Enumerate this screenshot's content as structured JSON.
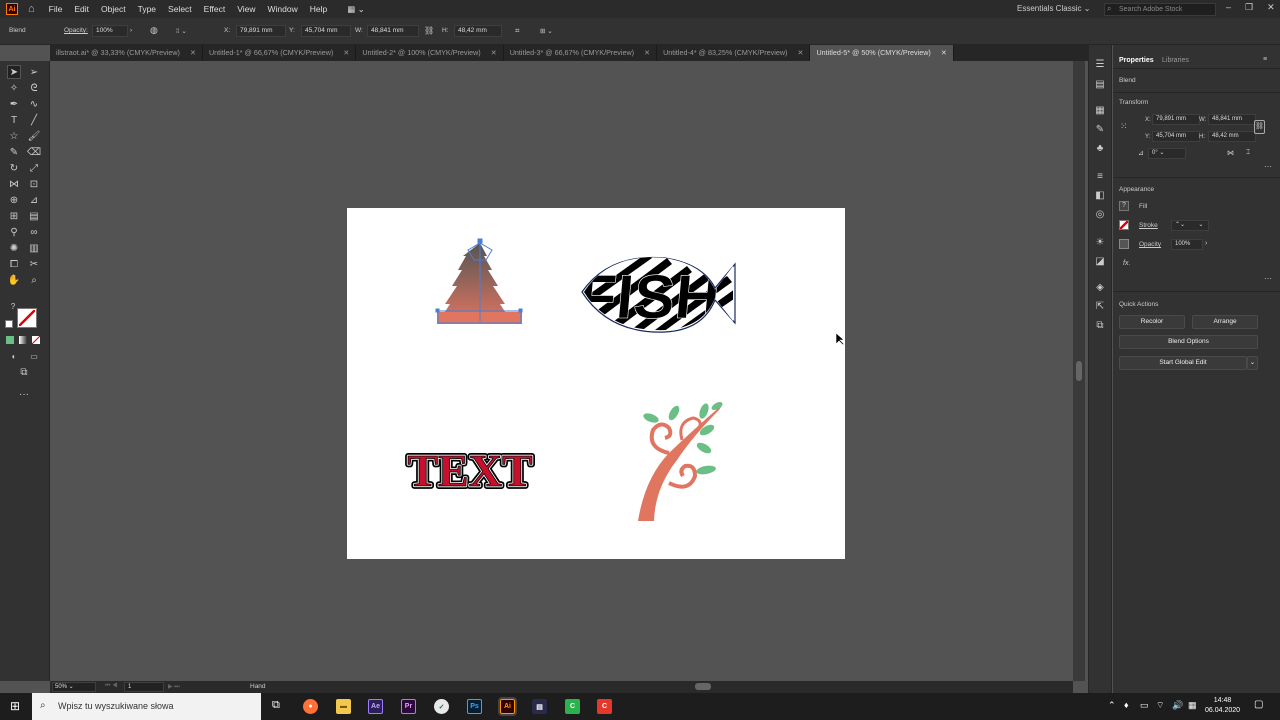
{
  "menubar": {
    "logo": "Ai",
    "home_icon": "home-icon",
    "items": [
      "File",
      "Edit",
      "Object",
      "Type",
      "Select",
      "Effect",
      "View",
      "Window",
      "Help"
    ],
    "workspace": "Essentials Classic",
    "search_placeholder": "Search Adobe Stock"
  },
  "controlbar": {
    "selection_label": "Blend",
    "opacity_label": "Opacity:",
    "opacity_value": "100%",
    "x_label": "X:",
    "x_value": "79,891 mm",
    "y_label": "Y:",
    "y_value": "45,704 mm",
    "w_label": "W:",
    "w_value": "48,841 mm",
    "h_label": "H:",
    "h_value": "48,42 mm"
  },
  "tabs": [
    {
      "label": "illstraot.ai* @ 33,33% (CMYK/Preview)",
      "active": false
    },
    {
      "label": "Untitled-1* @ 66,67% (CMYK/Preview)",
      "active": false
    },
    {
      "label": "Untitled-2* @ 100% (CMYK/Preview)",
      "active": false
    },
    {
      "label": "Untitled-3* @ 66,67% (CMYK/Preview)",
      "active": false
    },
    {
      "label": "Untitled-4* @ 83,25% (CMYK/Preview)",
      "active": false
    },
    {
      "label": "Untitled-5* @ 50% (CMYK/Preview)",
      "active": true
    }
  ],
  "artwork": {
    "fish_text": "FISH",
    "text_word": "TEXT",
    "colors": {
      "salmon": "#e07560",
      "leaf": "#6bbf86",
      "red": "#c8102e",
      "selection": "#4a7ed8"
    }
  },
  "statusbar": {
    "zoom": "50%",
    "artboard_num": "1",
    "tool": "Hand"
  },
  "panel": {
    "tab_properties": "Properties",
    "tab_libraries": "Libraries",
    "selection": "Blend",
    "transform_title": "Transform",
    "x_label": "X:",
    "x_value": "79,891 mm",
    "y_label": "Y:",
    "y_value": "45,704 mm",
    "w_label": "W:",
    "w_value": "48,841 mm",
    "h_label": "H:",
    "h_value": "48,42 mm",
    "angle_value": "0°",
    "appearance_title": "Appearance",
    "fill_label": "Fill",
    "stroke_label": "Stroke",
    "opacity_label": "Opacity",
    "opacity_value": "100%",
    "fx_label": "fx.",
    "quick_actions_title": "Quick Actions",
    "recolor": "Recolor",
    "arrange": "Arrange",
    "blend_options": "Blend Options",
    "start_global_edit": "Start Global Edit"
  },
  "taskbar": {
    "search_placeholder": "Wpisz tu wyszukiwane słowa",
    "time": "14:48",
    "date": "06.04.2020"
  }
}
